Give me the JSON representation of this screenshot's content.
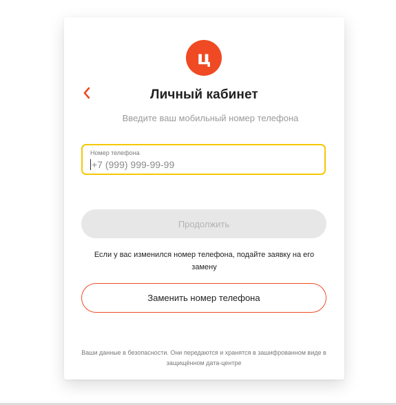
{
  "logo": {
    "letter": "ц",
    "color": "#ef4a23"
  },
  "header": {
    "back_icon": "chevron-left-icon",
    "title": "Личный кабинет",
    "subtitle": "Введите ваш мобильный номер телефона"
  },
  "phone_field": {
    "label": "Номер телефона",
    "placeholder": "+7 (999) 999-99-99",
    "value": "",
    "border_color": "#f5c800"
  },
  "continue_button": {
    "label": "Продолжить",
    "state": "disabled"
  },
  "change_note": "Если у вас изменился номер телефона, подайте заявку на его замену",
  "replace_button": {
    "label": "Заменить номер телефона"
  },
  "security_note": "Ваши данные в безопасности. Они передаются и хранятся в зашифрованном виде в защищённом дата-центре",
  "colors": {
    "accent": "#ef4a23",
    "focus": "#f5c800",
    "disabled_bg": "#e7e7e7"
  }
}
